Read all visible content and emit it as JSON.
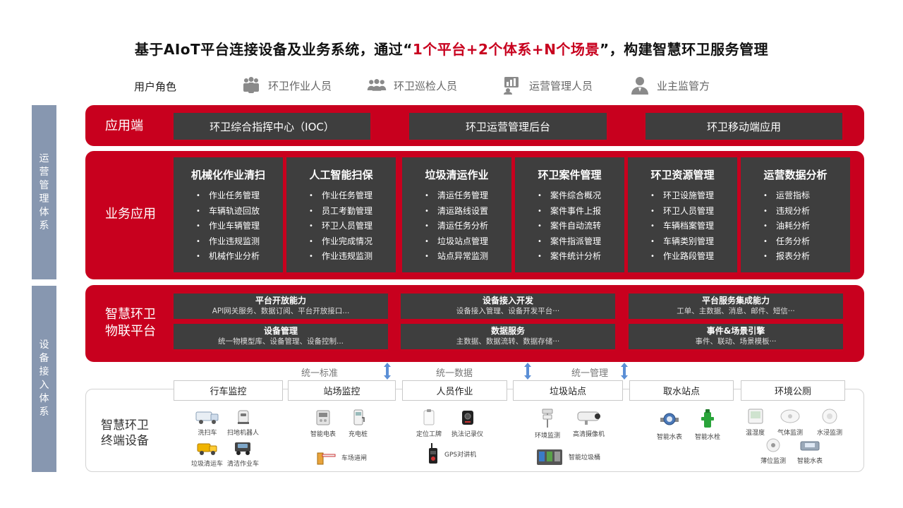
{
  "title": {
    "prefix": "基于AIoT平台连接设备及业务系统，通过“",
    "highlight": "1个平台+2个体系+N个场景",
    "suffix": "”，构建智慧环卫服务管理"
  },
  "roles": {
    "label": "用户角色",
    "items": [
      {
        "label": "环卫作业人员",
        "icon": "workers-group-icon"
      },
      {
        "label": "环卫巡检人员",
        "icon": "inspectors-icon"
      },
      {
        "label": "运营管理人员",
        "icon": "dashboard-icon"
      },
      {
        "label": "业主监管方",
        "icon": "supervisor-icon"
      }
    ]
  },
  "side_bars": {
    "ops": "运营管理体系",
    "device": "设备接入体系"
  },
  "app_layer": {
    "label": "应用端",
    "items": [
      "环卫综合指挥中心（IOC）",
      "环卫运营管理后台",
      "环卫移动端应用"
    ]
  },
  "biz_layer": {
    "label": "业务应用",
    "columns": [
      {
        "title": "机械化作业清扫",
        "items": [
          "作业任务管理",
          "车辆轨迹回放",
          "作业车辆管理",
          "作业违规监测",
          "机械作业分析"
        ]
      },
      {
        "title": "人工智能扫保",
        "items": [
          "作业任务管理",
          "员工考勤管理",
          "环卫人员管理",
          "作业完成情况",
          "作业违规监测"
        ]
      },
      {
        "title": "垃圾清运作业",
        "items": [
          "清运任务管理",
          "清运路线设置",
          "清运任务分析",
          "垃圾站点管理",
          "站点异常监测"
        ]
      },
      {
        "title": "环卫案件管理",
        "items": [
          "案件综合概况",
          "案件事件上报",
          "案件自动流转",
          "案件指派管理",
          "案件统计分析"
        ]
      },
      {
        "title": "环卫资源管理",
        "items": [
          "环卫设施管理",
          "环卫人员管理",
          "车辆档案管理",
          "车辆类别管理",
          "作业路段管理"
        ]
      },
      {
        "title": "运营数据分析",
        "items": [
          "运营指标",
          "违规分析",
          "油耗分析",
          "任务分析",
          "报表分析"
        ]
      }
    ]
  },
  "iot_layer": {
    "label_line1": "智慧环卫",
    "label_line2": "物联平台",
    "boxes": [
      {
        "title": "平台开放能力",
        "desc": "API网关服务、数据订阅、平台开放接口..."
      },
      {
        "title": "设备接入开发",
        "desc": "设备接入管理、设备开发平台···"
      },
      {
        "title": "平台服务集成能力",
        "desc": "工单、主数据、消息、邮件、短信···"
      },
      {
        "title": "设备管理",
        "desc": "统一物模型库、设备管理、设备控制..."
      },
      {
        "title": "数据服务",
        "desc": "主数据、数据流转、数据存储···"
      },
      {
        "title": "事件&场景引擎",
        "desc": "事件、联动、场景模板···"
      }
    ]
  },
  "unify": [
    "统一标准",
    "统一数据",
    "统一管理"
  ],
  "terminal": {
    "label_line1": "智慧环卫",
    "label_line2": "终端设备",
    "categories": [
      "行车监控",
      "站场监控",
      "人员作业",
      "垃圾站点",
      "取水站点",
      "环境公厕"
    ],
    "devices": {
      "sweeper": "洗扫车",
      "robot": "扫地机器人",
      "garbage_truck": "垃圾清运车",
      "cleaning_truck": "清洁作业车",
      "smart_meter": "智能电表",
      "charger": "充电桩",
      "barrier": "车场道闸",
      "badge": "定位工牌",
      "recorder": "执法记录仪",
      "walkie": "GPS对讲机",
      "env_monitor": "环境监测",
      "hd_camera": "高清摄像机",
      "smart_bin": "智能垃圾桶",
      "water_meter": "智能水表",
      "hydrant": "智能水栓",
      "humidity": "温湿度",
      "gas": "气体监测",
      "flood": "水浸监测",
      "level": "薄位监测",
      "water_meter2": "智能水表"
    }
  }
}
